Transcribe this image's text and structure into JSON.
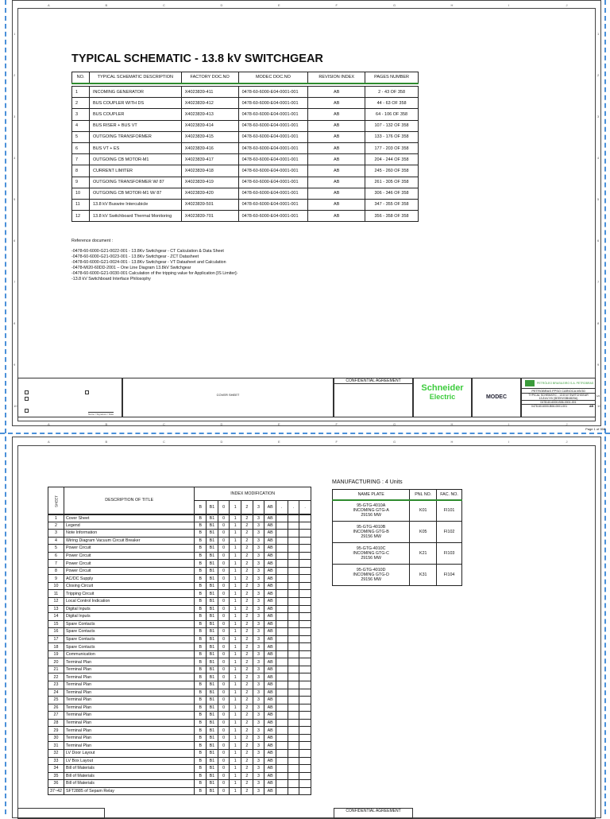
{
  "columns": [
    "A",
    "B",
    "C",
    "D",
    "E",
    "F",
    "G",
    "H",
    "I",
    "J"
  ],
  "rows": [
    "1",
    "2",
    "3",
    "4",
    "5",
    "6",
    "7",
    "8",
    "9",
    "10"
  ],
  "page1": {
    "title": "TYPICAL SCHEMATIC - 13.8 kV SWITCHGEAR",
    "headers": [
      "NO.",
      "TYPICAL SCHEMATIC DESCRIPTION",
      "FACTORY DOC.NO",
      "MODEC DOC.NO",
      "REVISION INDEX",
      "PAGES NUMBER"
    ],
    "table": [
      [
        "1",
        "INCOMING GENERATOR",
        "X4023839-411",
        "0478-60-6000-E04-0001-001",
        "AB",
        "2 - 43  OF  358"
      ],
      [
        "2",
        "BUS COUPLER WITH DS",
        "X4023839-412",
        "0478-60-6000-E04-0001-001",
        "AB",
        "44 - 63  OF  358"
      ],
      [
        "3",
        "BUS COUPLER",
        "X4023839-413",
        "0478-60-6000-E04-0001-001",
        "AB",
        "64 - 106  OF  358"
      ],
      [
        "4",
        "BUS RISER + BUS VT",
        "X4023839-414",
        "0478-60-6000-E04-0001-001",
        "AB",
        "107 - 132  OF  358"
      ],
      [
        "5",
        "OUTGOING TRANSFORMER",
        "X4023839-415",
        "0478-60-6000-E04-0001-001",
        "AB",
        "133 - 176  OF  358"
      ],
      [
        "6",
        "BUS VT + ES",
        "X4023839-416",
        "0478-60-6000-E04-0001-001",
        "AB",
        "177 - 203  OF  358"
      ],
      [
        "7",
        "OUTGOING CB MOTOR-M1",
        "X4023839-417",
        "0478-60-6000-E04-0001-001",
        "AB",
        "204 - 244  OF  358"
      ],
      [
        "8",
        "CURRENT LIMITER",
        "X4023839-418",
        "0478-60-6000-E04-0001-001",
        "AB",
        "245 - 260  OF  358"
      ],
      [
        "9",
        "OUTGOING TRANSFORMER W/ 87",
        "X4023839-419",
        "0478-60-6000-E04-0001-001",
        "AB",
        "261 - 305  OF  358"
      ],
      [
        "10",
        "OUTGOING CB MOTOR-M1 W/ 87",
        "X4023839-420",
        "0478-60-6000-E04-0001-001",
        "AB",
        "306 - 346  OF  358"
      ],
      [
        "11",
        "13.8  kV Buswire Intercubicle",
        "X4023839-501",
        "0478-60-6000-E04-0001-001",
        "AB",
        "347 - 355  OF  358"
      ],
      [
        "12",
        "13.8  kV Switchboard Thermal Monitoring",
        "X4023839-701",
        "0478-60-6000-E04-0001-001",
        "AB",
        "356 - 358  OF  358"
      ]
    ],
    "reference_title": "Reference document :",
    "references": [
      "-0478-60-6000-G21-0022-001 - 13.8Kv Switchgear - CT Calculation & Data Sheet",
      "-0478-60-6000-G21-0023-001 - 13.8Kv Switchgear - ZCT Datasheet",
      "-0478-60-6000-G21-0024-001 - 13.8Kv Switchgear - VT Datasheet and Calculation",
      "-0478-MI20-60DD-2001 – One Line Diagram 13.8kV Switchgear",
      "-0478-60-6000-G21-0030-001 Calculation of the tripping value for Application [IS Limiter]-",
      "-13.8 kV Switchboard Interface Philosophy"
    ],
    "titleblock": {
      "cover": "COVER SHEET",
      "confidential": "CONFIDENTIAL AGREEMENT",
      "schneider": "Schneider",
      "electric": "Electric",
      "modec": "MODEC",
      "petrobras_logo": "PETRÓLEO BRASILEIRO S.A. PETROBRAS",
      "client": "PETROBRAS FPSO CARIOCA MV30",
      "doc_title": "TYPICAL SCHEMATIC - 13.8 kV SWITCHGEAR",
      "doc_sub": "13.8 kV HV (5EEHV/3B/4820A)",
      "doc_no1": "0478-60-6000-B06-0001-001",
      "doc_no2": "0478-60-6000-B06-0001-001",
      "rev": "AB",
      "sheet": "1/2",
      "signature": "Name / Signature / Date"
    },
    "page_label": "Page 1 of 358"
  },
  "page2": {
    "sheet_header": "SHEET",
    "desc_header": "DESCRIPTION OF TITLE",
    "index_header": "INDEX MODIFICATION",
    "index_cols": [
      "B",
      "B1",
      "0",
      "1",
      "2",
      "3",
      "AB",
      ".",
      ".",
      "."
    ],
    "index_values": [
      "B",
      "B1",
      "0",
      "1",
      "2",
      "3",
      "AB",
      "",
      "",
      ""
    ],
    "rows": [
      [
        "1",
        "Cover Sheet"
      ],
      [
        "2",
        "Legend"
      ],
      [
        "3",
        "Note Information"
      ],
      [
        "4",
        "Wiring Diagram Vacuum Circuit Breaker"
      ],
      [
        "5",
        "Power Circuit"
      ],
      [
        "6",
        "Power Circuit"
      ],
      [
        "7",
        "Power Circuit"
      ],
      [
        "8",
        "Power Circuit"
      ],
      [
        "9",
        "AC/DC Supply"
      ],
      [
        "10",
        "Closing Circuit"
      ],
      [
        "11",
        "Tripping Circuit"
      ],
      [
        "12",
        "Local Control Indication"
      ],
      [
        "13",
        "Digital Inputs"
      ],
      [
        "14",
        "Digital Inputs"
      ],
      [
        "15",
        "Spare Contacts"
      ],
      [
        "16",
        "Spare Contacts"
      ],
      [
        "17",
        "Spare Contacts"
      ],
      [
        "18",
        "Spare Contacts"
      ],
      [
        "19",
        "Communication"
      ],
      [
        "20",
        "Terminal Plan"
      ],
      [
        "21",
        "Terminal Plan"
      ],
      [
        "22",
        "Terminal Plan"
      ],
      [
        "23",
        "Terminal Plan"
      ],
      [
        "24",
        "Terminal Plan"
      ],
      [
        "25",
        "Terminal Plan"
      ],
      [
        "26",
        "Terminal Plan"
      ],
      [
        "27",
        "Terminal Plan"
      ],
      [
        "28",
        "Terminal Plan"
      ],
      [
        "29",
        "Terminal Plan"
      ],
      [
        "30",
        "Terminal Plan"
      ],
      [
        "31",
        "Terminal Plan"
      ],
      [
        "32",
        "LV Door Layout"
      ],
      [
        "33",
        "LV Box Layout"
      ],
      [
        "34",
        "Bill of Materials"
      ],
      [
        "35",
        "Bill of Materials"
      ],
      [
        "36",
        "Bill of Materials"
      ],
      [
        "37~42",
        "SFT2885 of Sepam Relay"
      ]
    ],
    "manufacturing_title": "MANUFACTURING : 4 Units",
    "mfg_headers": [
      "NAME PLATE",
      "PNL NO.",
      "FAC. NO."
    ],
    "mfg_rows": [
      [
        "95-GTG-4010A",
        "INCOMING GTG-A",
        "29156 MW",
        "K01",
        "FI101"
      ],
      [
        "95-GTG-4010B",
        "INCOMING GTG-B",
        "29156 MW",
        "K05",
        "FI102"
      ],
      [
        "95-GTG-4010C",
        "INCOMING GTG-C",
        "29156 MW",
        "K21",
        "FI103"
      ],
      [
        "95-GTG-4010D",
        "INCOMING GTG-D",
        "29156 MW",
        "K31",
        "FI104"
      ]
    ],
    "confidential": "CONFIDENTIAL AGREEMENT"
  },
  "colors": {
    "green": "#2e8b2e",
    "schneider": "#3dcc3d",
    "accent_blue": "#4a90d9"
  }
}
